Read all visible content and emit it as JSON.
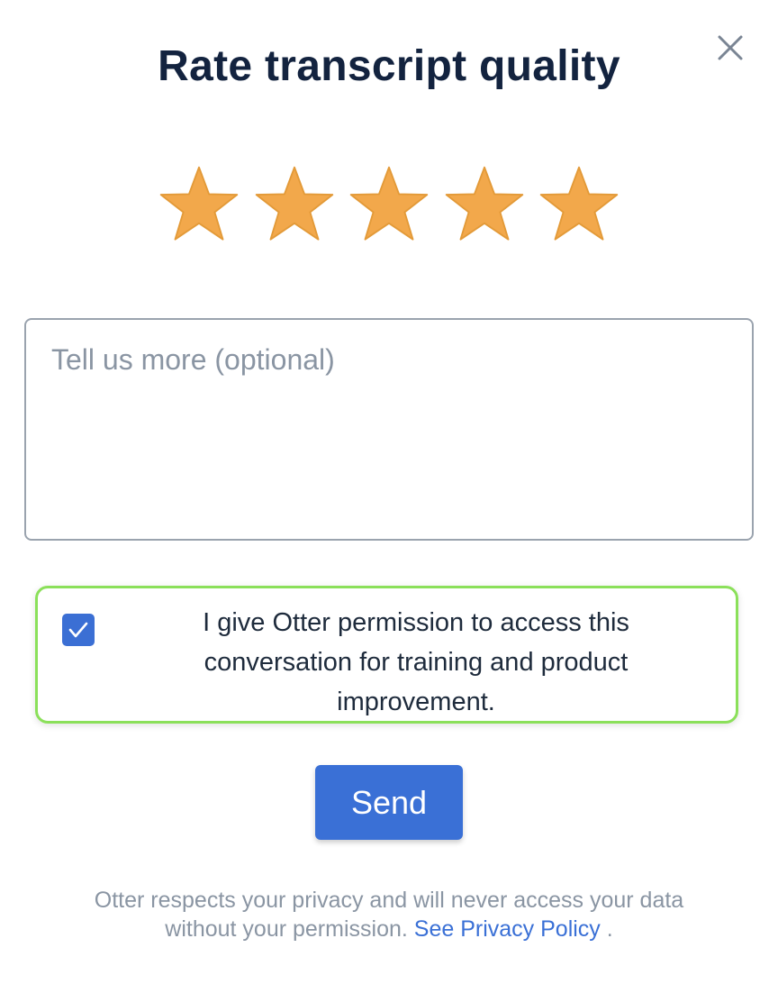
{
  "dialog": {
    "title": "Rate transcript quality",
    "close_icon": "close-icon"
  },
  "rating": {
    "value": 5,
    "max": 5,
    "star_color": "#F2A84B",
    "star_icon": "star-icon"
  },
  "feedback": {
    "value": "",
    "placeholder": "Tell us more (optional)"
  },
  "consent": {
    "checked": true,
    "label_line1": "I give Otter permission to access this",
    "label_line2": "conversation for training and product",
    "label_line3": "improvement.",
    "highlight_color": "#8BE05A",
    "checkbox_color": "#3B6FD4"
  },
  "send": {
    "label": "Send",
    "color": "#3A70D6"
  },
  "footer": {
    "line1": "Otter respects your privacy and will never access your data",
    "line2": "without your permission.",
    "link_label": "See Privacy Policy",
    "trailing": "."
  }
}
